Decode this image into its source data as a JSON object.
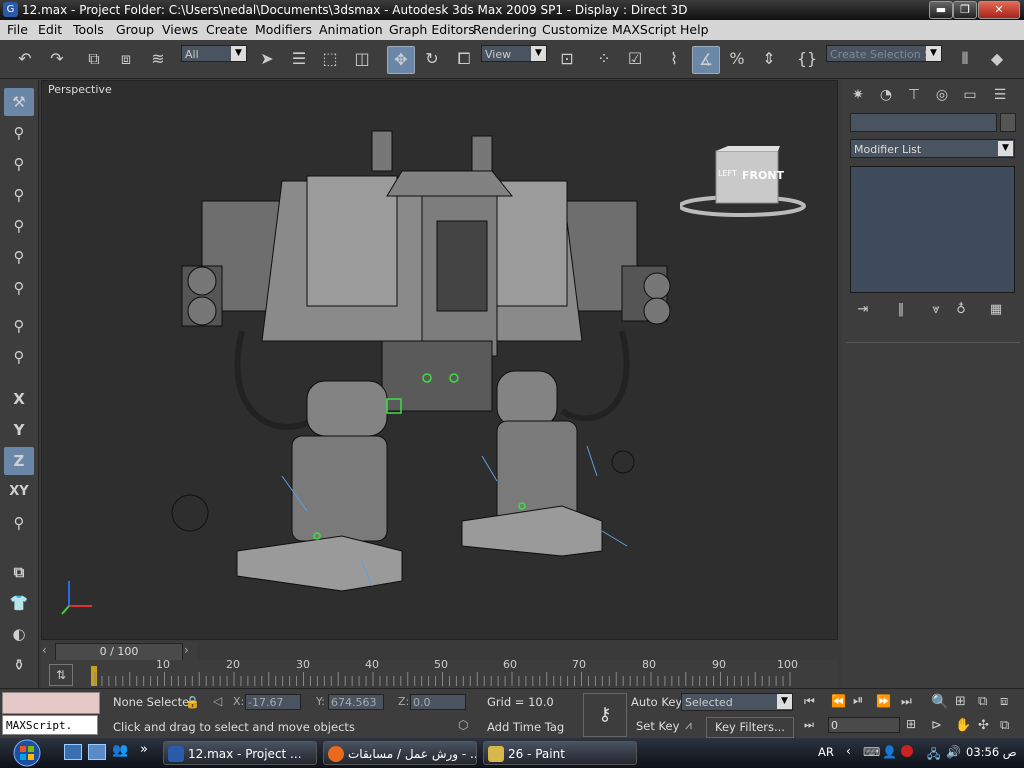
{
  "window": {
    "title": "12.max    - Project Folder: C:\\Users\\nedal\\Documents\\3dsmax     - Autodesk 3ds Max  2009 SP1       - Display : Direct 3D",
    "min_glyph": "▬",
    "max_glyph": "❐",
    "close_glyph": "✕"
  },
  "menu": [
    "File",
    "Edit",
    "Tools",
    "Group",
    "Views",
    "Create",
    "Modifiers",
    "Animation",
    "Graph Editors",
    "Rendering",
    "Customize",
    "MAXScript",
    "Help"
  ],
  "toolbar": {
    "selection_filter": "All",
    "reference_coord": "View",
    "named_selection_placeholder": "Create Selection Se"
  },
  "left_toolbar": {
    "axis_labels": [
      "X",
      "Y",
      "Z",
      "XY"
    ],
    "active_axis": "Z"
  },
  "viewport": {
    "label": "Perspective",
    "viewcube_front": "FRONT",
    "viewcube_left": "LEFT"
  },
  "command_panel": {
    "modifier_list": "Modifier List"
  },
  "time_slider": {
    "frame": "0 / 100",
    "ticks": [
      "10",
      "20",
      "30",
      "40",
      "50",
      "60",
      "70",
      "80",
      "90",
      "100"
    ]
  },
  "status": {
    "maxscript_listener": "MAXScript.",
    "selection_status": "None Selecte",
    "x_label": "X:",
    "x_value": "-17.67",
    "y_label": "Y:",
    "y_value": "674.563",
    "z_label": "Z:",
    "z_value": "0.0",
    "grid": "Grid = 10.0",
    "prompt": "Click and drag to select and move objects",
    "add_time_tag": "Add Time Tag",
    "auto_key": "Auto Key",
    "set_key": "Set Key",
    "key_mode": "Selected",
    "key_filters": "Key Filters...",
    "current_frame": "0"
  },
  "taskbar": {
    "tasks": [
      {
        "label": "12.max    - Project ..."
      },
      {
        "label": "ورش عمل / مسابقات - ..."
      },
      {
        "label": "26 - Paint"
      }
    ],
    "language": "AR",
    "clock": "03:56 ص"
  },
  "colors": {
    "viewport_bg": "#2e2e2e",
    "ui_bg": "#3d3d3d",
    "active_button": "#6b87a8",
    "modifier_stack": "#3e4b5b"
  }
}
